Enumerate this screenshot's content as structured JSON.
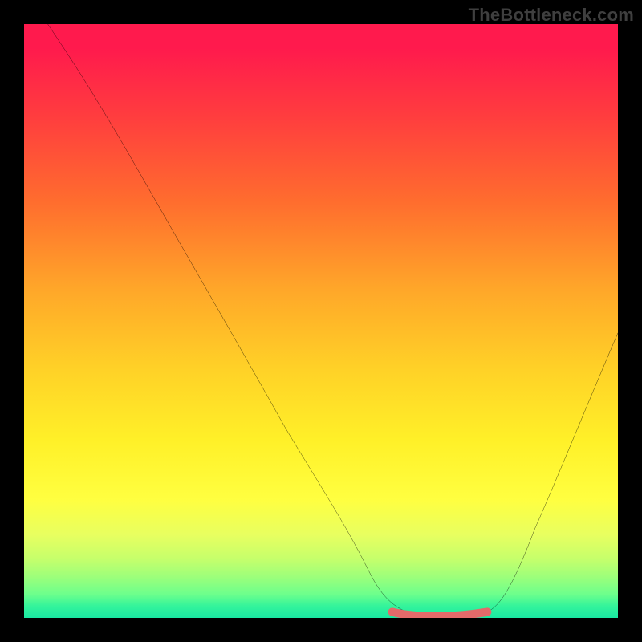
{
  "watermark": "TheBottleneck.com",
  "chart_data": {
    "type": "line",
    "title": "",
    "xlabel": "",
    "ylabel": "",
    "xlim": [
      0,
      100
    ],
    "ylim": [
      0,
      100
    ],
    "grid": false,
    "legend": false,
    "background": {
      "type": "vertical-gradient",
      "stops": [
        {
          "pos": 0,
          "color": "#ff1a4d"
        },
        {
          "pos": 15,
          "color": "#ff3b3f"
        },
        {
          "pos": 30,
          "color": "#ff6d2e"
        },
        {
          "pos": 45,
          "color": "#ffa829"
        },
        {
          "pos": 58,
          "color": "#ffd127"
        },
        {
          "pos": 70,
          "color": "#fff028"
        },
        {
          "pos": 80,
          "color": "#ffff40"
        },
        {
          "pos": 90,
          "color": "#c6ff6b"
        },
        {
          "pos": 100,
          "color": "#19e8a2"
        }
      ]
    },
    "series": [
      {
        "name": "bottleneck-curve",
        "color": "#000000",
        "stroke_width": 2,
        "x": [
          4,
          10,
          20,
          30,
          40,
          50,
          56,
          60,
          64,
          70,
          76,
          80,
          86,
          92,
          100
        ],
        "values": [
          100,
          90,
          74,
          58,
          42,
          25,
          14,
          6,
          2,
          0,
          0,
          5,
          15,
          28,
          48
        ]
      },
      {
        "name": "optimal-band",
        "color": "#e46a6a",
        "stroke_width": 10,
        "linecap": "round",
        "x": [
          62,
          68,
          74,
          78
        ],
        "values": [
          1,
          0,
          0,
          1
        ]
      }
    ]
  }
}
